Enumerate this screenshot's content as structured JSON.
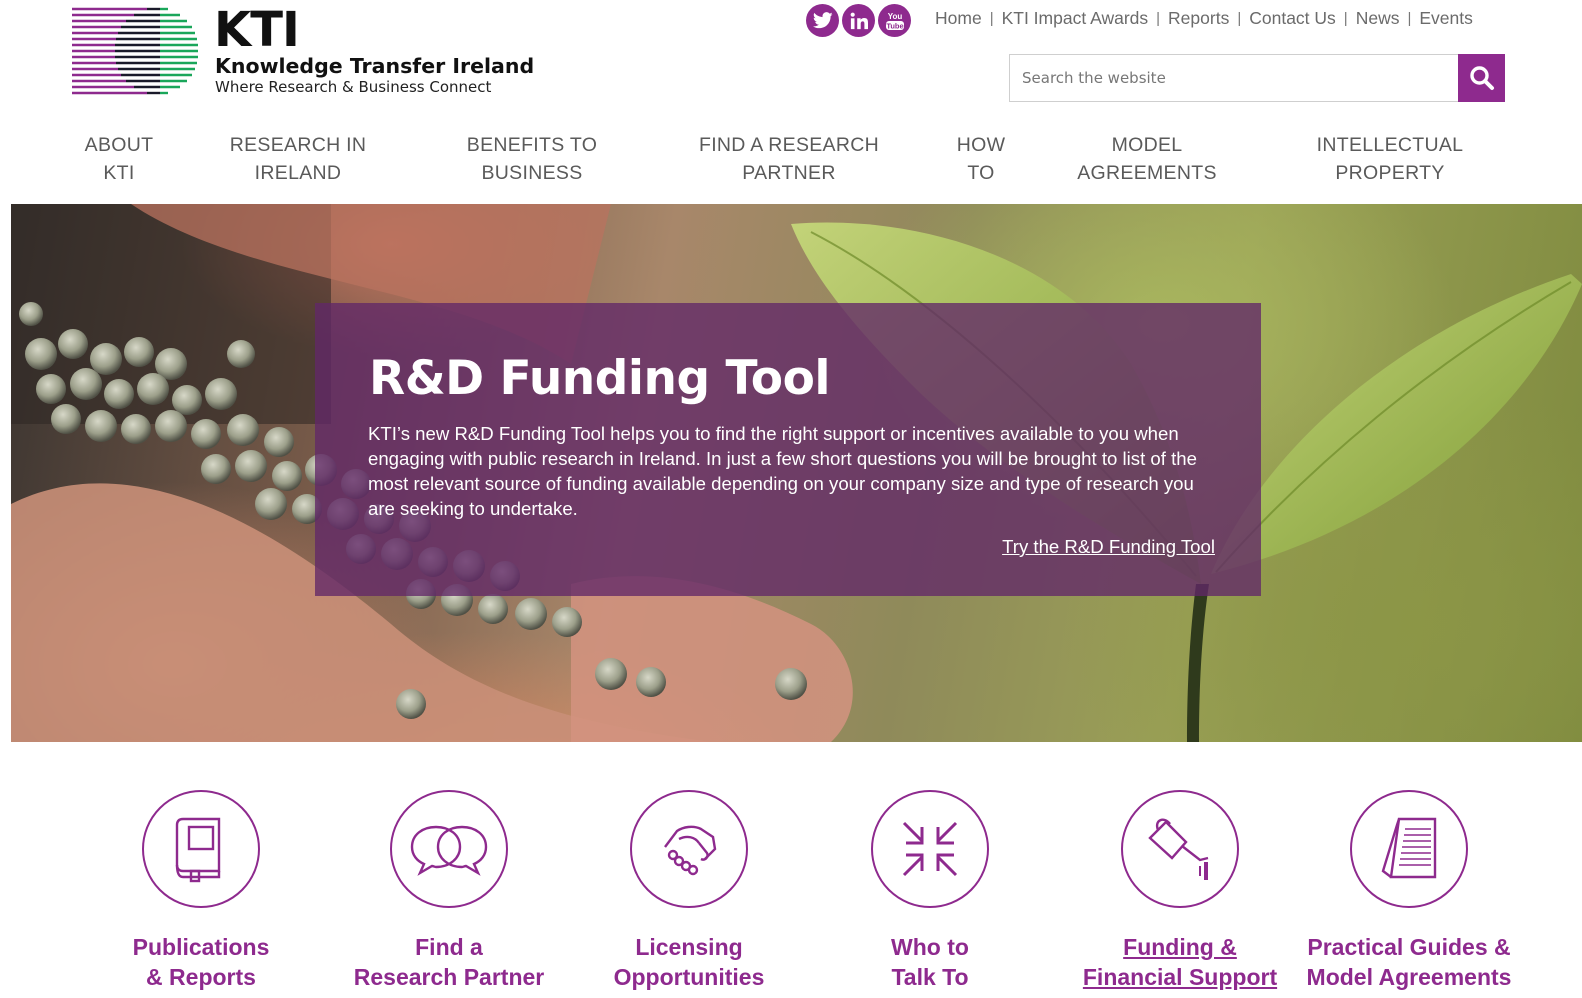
{
  "brand": {
    "logo_title": "KTI",
    "logo_name": "Knowledge Transfer Ireland",
    "logo_tagline": "Where Research & Business Connect",
    "accent_color": "#8e2a8e"
  },
  "social": [
    {
      "icon": "twitter-icon",
      "label": "Twitter"
    },
    {
      "icon": "linkedin-icon",
      "label": "LinkedIn"
    },
    {
      "icon": "youtube-icon",
      "label": "YouTube"
    }
  ],
  "toplinks": [
    "Home",
    "KTI Impact Awards",
    "Reports",
    "Contact Us",
    "News",
    "Events"
  ],
  "search": {
    "placeholder": "Search the website"
  },
  "mainnav": [
    {
      "line1": "ABOUT",
      "line2": "KTI"
    },
    {
      "line1": "RESEARCH IN",
      "line2": "IRELAND"
    },
    {
      "line1": "BENEFITS TO",
      "line2": "BUSINESS"
    },
    {
      "line1": "FIND A RESEARCH",
      "line2": "PARTNER"
    },
    {
      "line1": "HOW",
      "line2": "TO"
    },
    {
      "line1": "MODEL",
      "line2": "AGREEMENTS"
    },
    {
      "line1": "INTELLECTUAL",
      "line2": "PROPERTY"
    }
  ],
  "hero": {
    "title": "R&D Funding Tool",
    "text": "KTI’s new R&D Funding Tool helps you to find the right support or incentives available to you when engaging with public research in Ireland. In just a few short questions you will be brought to list of the most relevant source of funding available depending on your company size and type of research you are seeking to undertake.",
    "link": "Try the R&D Funding Tool"
  },
  "features": [
    {
      "icon": "book-icon",
      "line1": "Publications",
      "line2": "& Reports"
    },
    {
      "icon": "speech-bubbles-icon",
      "line1": "Find a",
      "line2": "Research Partner"
    },
    {
      "icon": "handshake-icon",
      "line1": "Licensing",
      "line2": "Opportunities"
    },
    {
      "icon": "arrows-inward-icon",
      "line1": "Who to",
      "line2": "Talk To"
    },
    {
      "icon": "watering-can-icon",
      "line1": "Funding &",
      "line2": "Financial Support"
    },
    {
      "icon": "document-pages-icon",
      "line1": "Practical Guides &",
      "line2": "Model Agreements"
    }
  ]
}
